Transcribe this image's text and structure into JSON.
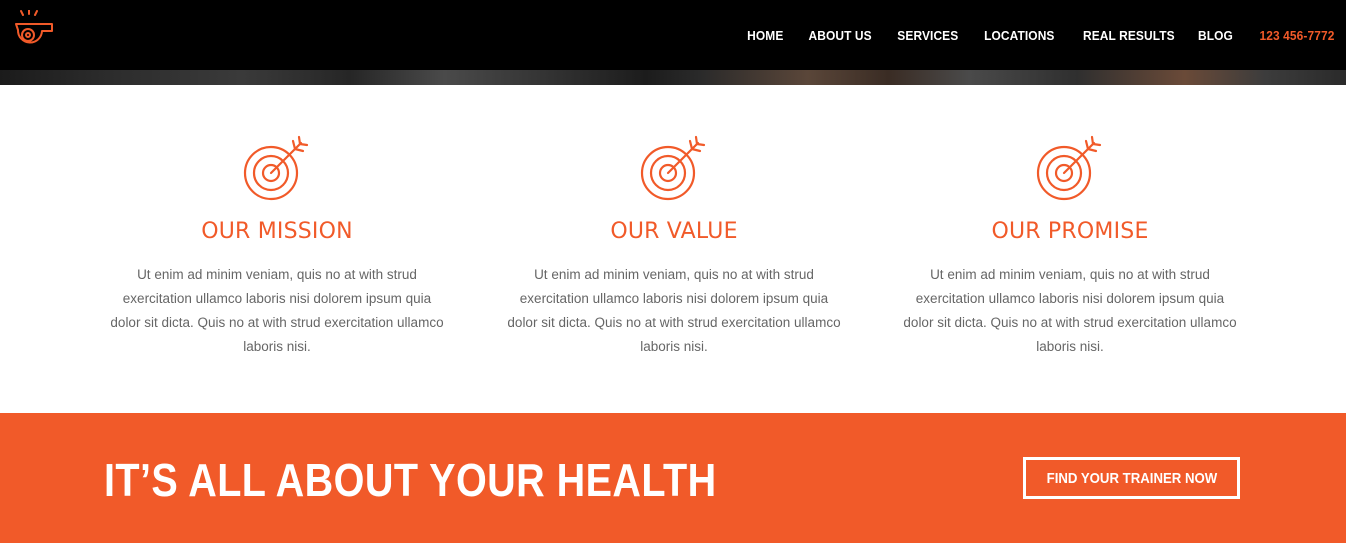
{
  "header": {
    "logo_icon": "whistle-icon",
    "nav": [
      {
        "label": "HOME"
      },
      {
        "label": "ABOUT US"
      },
      {
        "label": "SERVICES"
      },
      {
        "label": "LOCATIONS"
      },
      {
        "label": "REAL RESULTS"
      },
      {
        "label": "BLOG"
      }
    ],
    "phone": "123 456-7772"
  },
  "features": [
    {
      "icon": "target-arrow-icon",
      "title": "OUR MISSION",
      "body": "Ut enim ad minim veniam, quis no at with strud exercitation ullamco laboris nisi dolorem ipsum quia dolor sit dicta. Quis no at with strud exercitation ullamco laboris nisi."
    },
    {
      "icon": "target-arrow-icon",
      "title": "OUR VALUE",
      "body": "Ut enim ad minim veniam, quis no at with strud exercitation ullamco laboris nisi dolorem ipsum quia dolor sit dicta. Quis no at with strud exercitation ullamco laboris nisi."
    },
    {
      "icon": "target-arrow-icon",
      "title": "OUR PROMISE",
      "body": "Ut enim ad minim veniam, quis no at with strud exercitation ullamco laboris nisi dolorem ipsum quia dolor sit dicta. Quis no at with strud exercitation ullamco laboris nisi."
    }
  ],
  "cta": {
    "heading": "IT’S ALL ABOUT YOUR HEALTH",
    "button_label": "FIND YOUR TRAINER NOW"
  },
  "colors": {
    "accent": "#f15a29",
    "header_bg": "#000000",
    "body_text": "#666666",
    "white": "#ffffff"
  }
}
